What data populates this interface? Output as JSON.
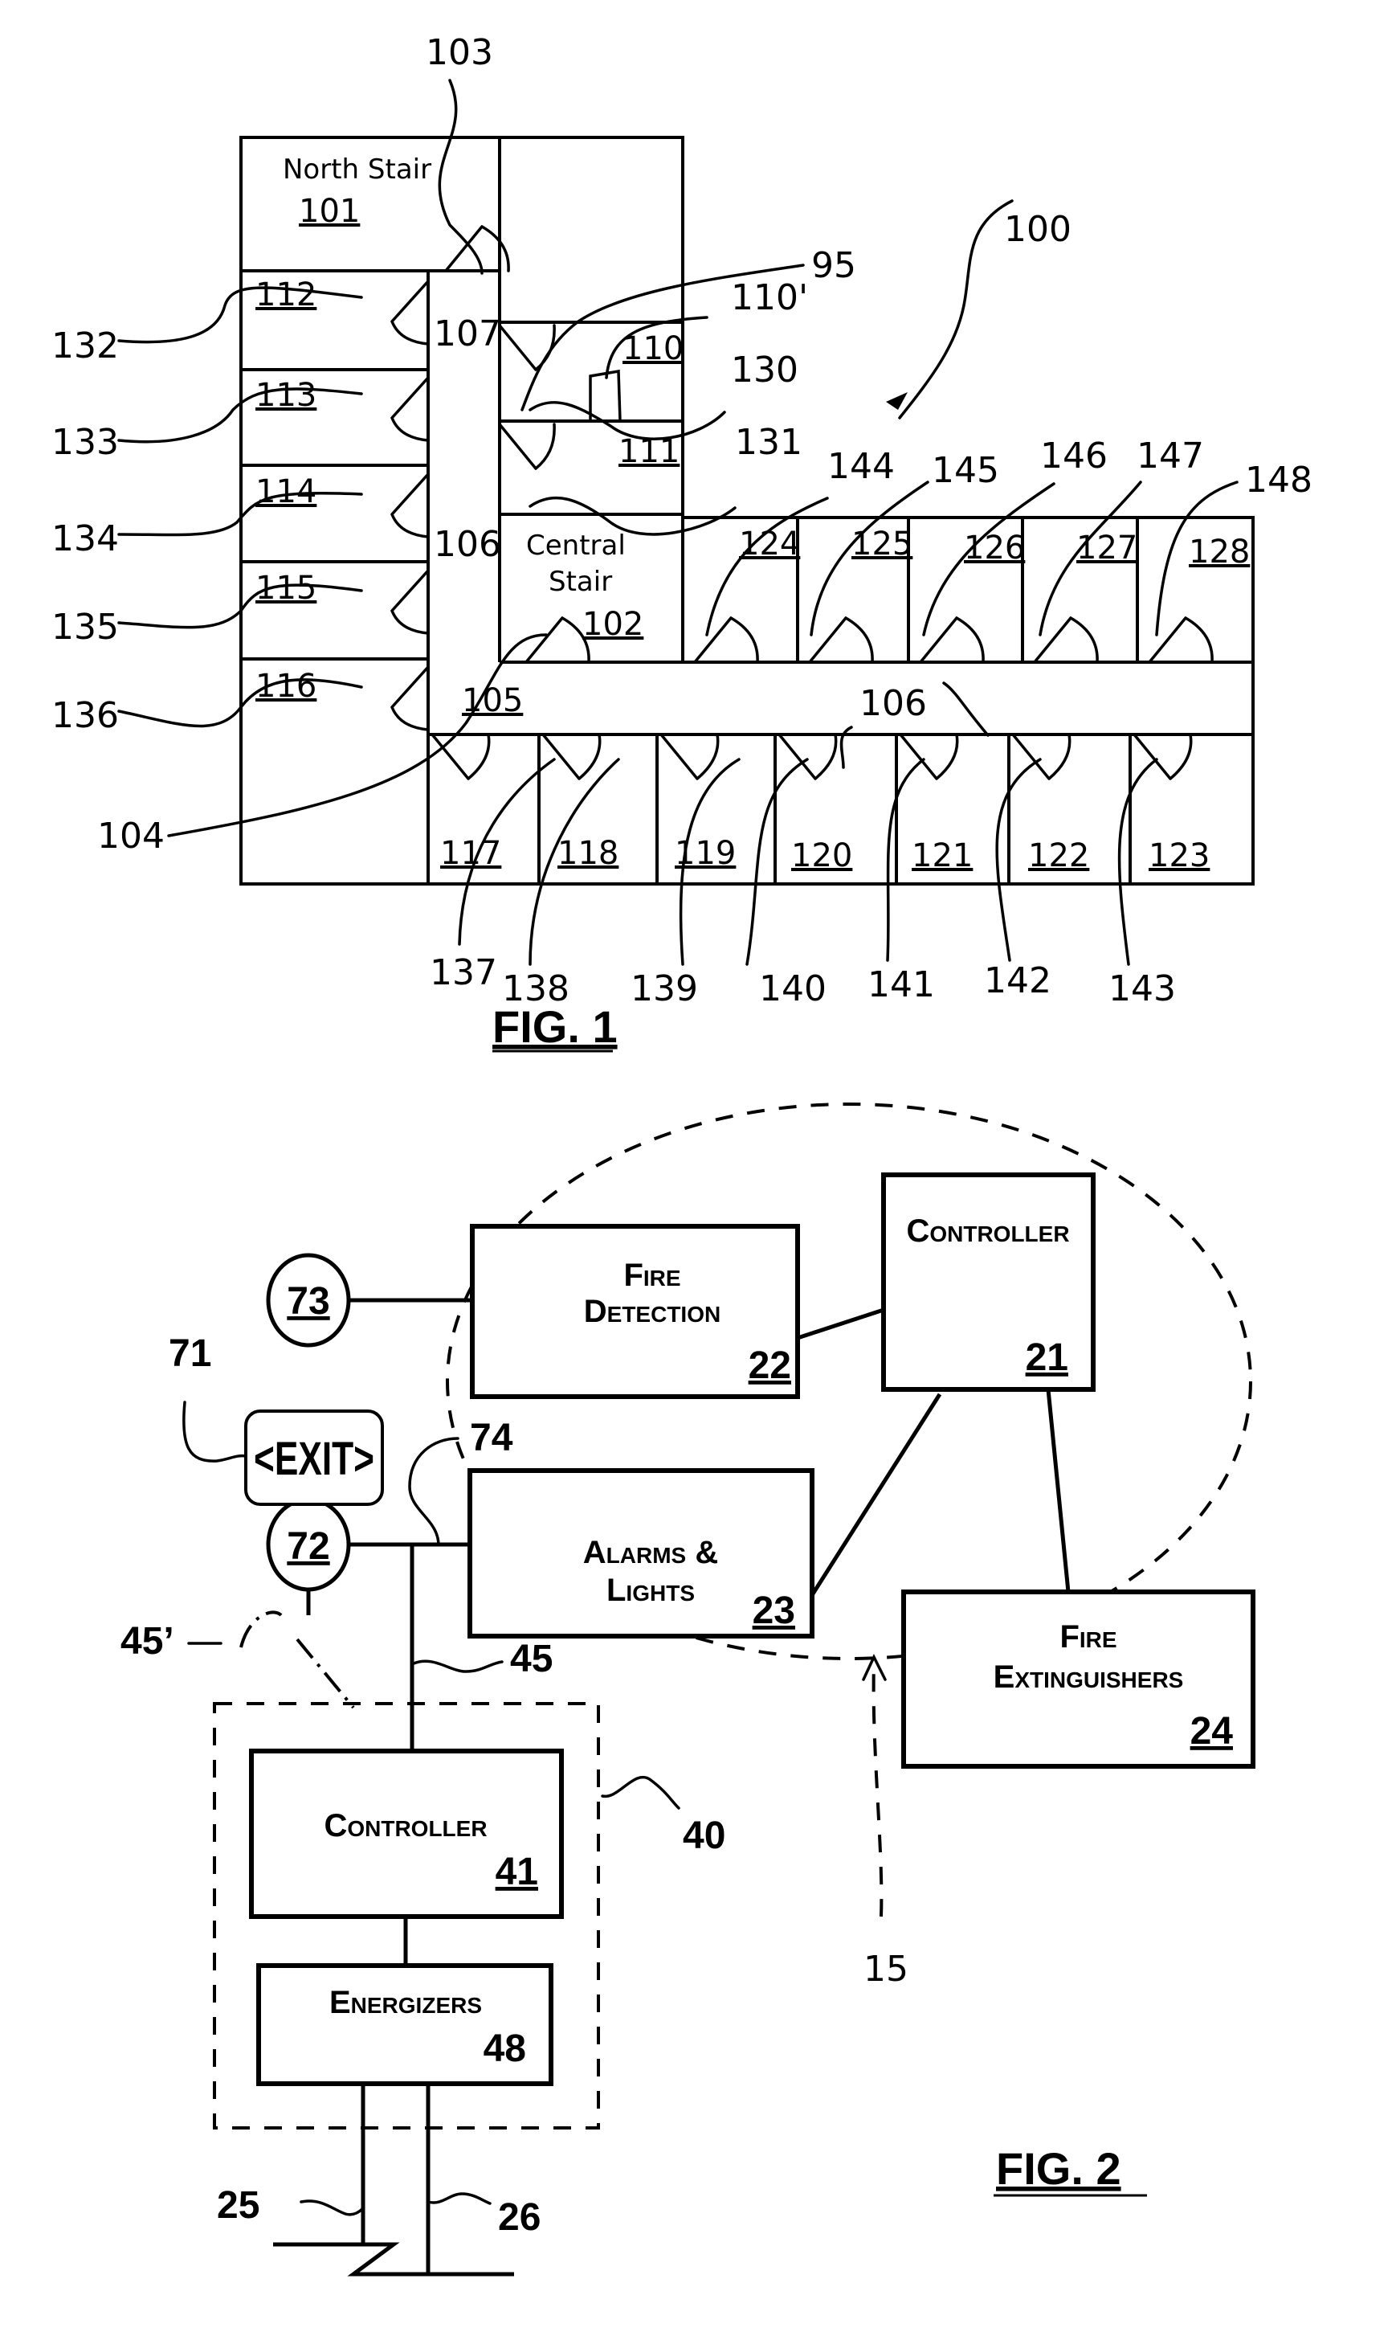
{
  "fig1": {
    "caption": "FIG. 1",
    "building_ref": "100",
    "stairs": [
      {
        "name": "North Stair",
        "id": "101"
      },
      {
        "name_line1": "Central",
        "name_line2": "Stair",
        "id": "102"
      }
    ],
    "corridors": {
      "c105": "105",
      "c106_vertical": "106",
      "c106_horizontal": "106",
      "c107": "107"
    },
    "rooms_left": [
      "112",
      "113",
      "114",
      "115",
      "116"
    ],
    "rooms_mid": [
      "110",
      "111"
    ],
    "rooms_top_right": [
      "124",
      "125",
      "126",
      "127",
      "128"
    ],
    "rooms_bottom": [
      "117",
      "118",
      "119",
      "120",
      "121",
      "122",
      "123"
    ],
    "door_refs_left": [
      "132",
      "133",
      "134",
      "135",
      "136"
    ],
    "door_refs_mid": [
      "130",
      "131"
    ],
    "door_refs_top": [
      "144",
      "145",
      "146",
      "147",
      "148"
    ],
    "door_refs_bottom": [
      "137",
      "138",
      "139",
      "140",
      "141",
      "142",
      "143"
    ],
    "other_refs": {
      "r103": "103",
      "r104": "104",
      "r95": "95",
      "r110p": "110'"
    }
  },
  "fig2": {
    "caption": "FIG. 2",
    "system_ref": "15",
    "blocks": {
      "controller_main": {
        "label": "Controller",
        "ref": "21"
      },
      "fire_detection": {
        "line1": "Fire",
        "line2": "Detection",
        "ref": "22"
      },
      "alarms_lights": {
        "line1": "Alarms &",
        "line2": "Lights",
        "ref": "23"
      },
      "fire_extinguishers": {
        "line1": "Fire",
        "line2": "Extinguishers",
        "ref": "24"
      },
      "controller_sub": {
        "label": "Controller",
        "ref": "41"
      },
      "energizers": {
        "label": "Energizers",
        "ref": "48"
      }
    },
    "devices": {
      "circle_top": "73",
      "circle_bottom": "72",
      "exit_sign": "<EXIT>",
      "exit_ref": "71"
    },
    "refs": {
      "r74": "74",
      "r45": "45",
      "r45p": "45’",
      "r40": "40",
      "r25": "25",
      "r26": "26"
    }
  }
}
